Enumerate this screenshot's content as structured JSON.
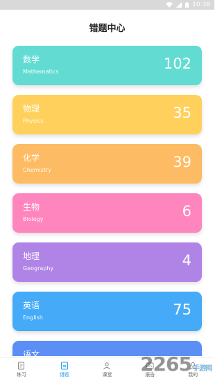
{
  "status_bar": {
    "time": "10:38"
  },
  "header": {
    "title": "错题中心"
  },
  "subjects": [
    {
      "name": "数学",
      "english": "Mathematics",
      "count": "102",
      "color": "#62dcd3"
    },
    {
      "name": "物理",
      "english": "Physics",
      "count": "35",
      "color": "#ffd15c"
    },
    {
      "name": "化学",
      "english": "Chemistry",
      "count": "39",
      "color": "#fdbb64"
    },
    {
      "name": "生物",
      "english": "Biology",
      "count": "6",
      "color": "#ff85be"
    },
    {
      "name": "地理",
      "english": "Geography",
      "count": "4",
      "color": "#b084e6"
    },
    {
      "name": "英语",
      "english": "English",
      "count": "75",
      "color": "#45aaf8"
    },
    {
      "name": "语文",
      "english": "",
      "count": "",
      "color": "#5b8ff5"
    }
  ],
  "tabs": [
    {
      "label": "练习",
      "icon": "practice-icon",
      "active": false
    },
    {
      "label": "错题",
      "icon": "mistakes-icon",
      "active": true
    },
    {
      "label": "课堂",
      "icon": "classroom-icon",
      "active": false
    },
    {
      "label": "报告",
      "icon": "report-icon",
      "active": false
    },
    {
      "label": "我的",
      "icon": "profile-icon",
      "active": false
    }
  ],
  "watermark": {
    "text": "2265",
    "suffix": "手游网"
  }
}
